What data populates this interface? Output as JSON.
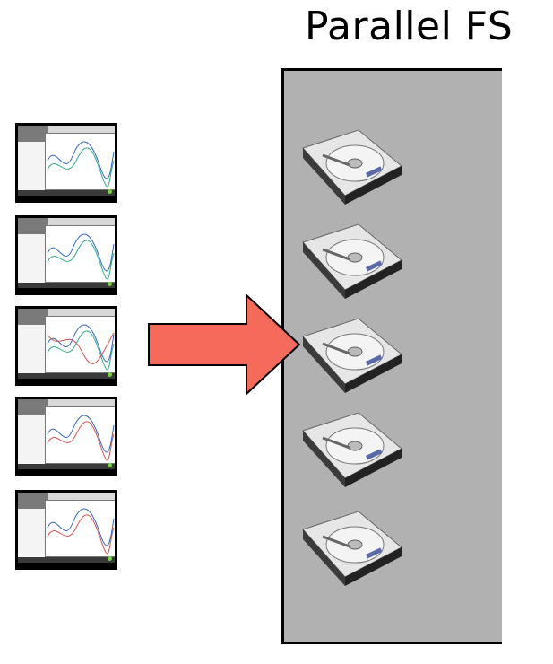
{
  "title": "Parallel FS",
  "nodes": [
    {
      "label": "",
      "name": "node-1"
    },
    {
      "label": "",
      "name": "node-2"
    },
    {
      "label": "",
      "name": "node-3"
    },
    {
      "label": "",
      "name": "node-4"
    },
    {
      "label": "",
      "name": "node-5"
    }
  ],
  "disks": [
    {
      "name": "hard-drive-1"
    },
    {
      "name": "hard-drive-2"
    },
    {
      "name": "hard-drive-3"
    },
    {
      "name": "hard-drive-4"
    },
    {
      "name": "hard-drive-5"
    }
  ],
  "colors": {
    "arrow": "#f56a5a",
    "fs_background": "#b1b1b1"
  }
}
